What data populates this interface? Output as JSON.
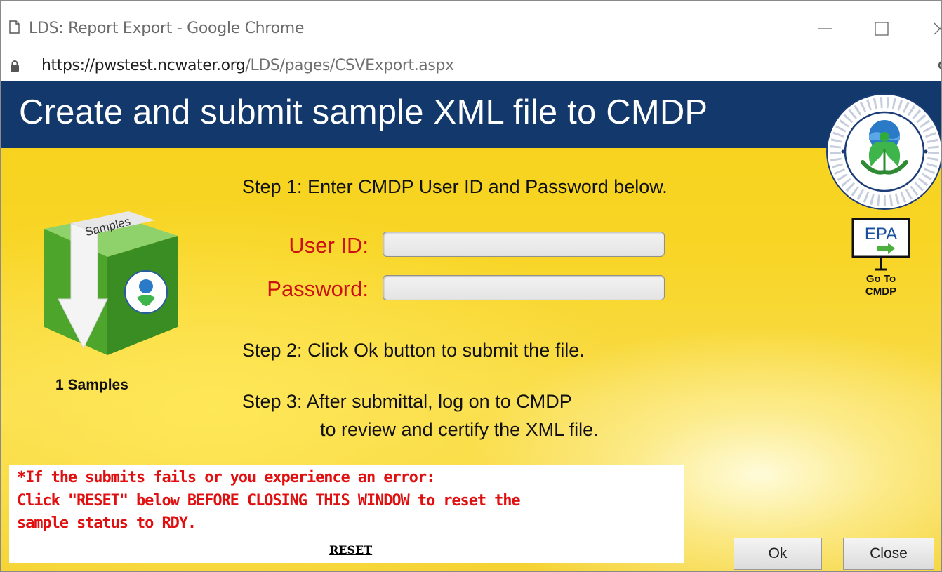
{
  "window": {
    "title": "LDS: Report Export - Google Chrome",
    "controls": [
      "minimize-icon",
      "maximize-icon",
      "close-icon"
    ]
  },
  "address_bar": {
    "url_host": "https://pwstest.ncwater.org",
    "url_path": "/LDS/pages/CSVExport.aspx",
    "icon": "lock-icon"
  },
  "banner": {
    "title": "Create and submit sample XML file to CMDP",
    "seal_icon": "epa-seal"
  },
  "samples": {
    "box_label": "Samples",
    "count_text": "1 Samples"
  },
  "steps": {
    "step1": "Step 1: Enter CMDP User ID and Password below.",
    "step2": "Step 2: Click Ok button to submit the file.",
    "step3_line1": "Step 3: After submittal, log on to CMDP",
    "step3_line2": "to review and certify the XML file."
  },
  "form": {
    "user_id_label": "User ID:",
    "user_id_value": "",
    "password_label": "Password:",
    "password_value": ""
  },
  "goto_cmdp": {
    "icon_text": "EPA",
    "line1": "Go To",
    "line2": "CMDP"
  },
  "warning": {
    "line1": "*If the submits fails or you experience an error:",
    "line2": "Click \"RESET\" below BEFORE CLOSING THIS WINDOW to reset the",
    "line3": "sample status to RDY.",
    "reset_label": "RESET"
  },
  "buttons": {
    "ok_label": "Ok",
    "close_label": "Close"
  },
  "colors": {
    "banner": "#13386b",
    "label_red": "#cc1111",
    "warning_red": "#e01010",
    "background_yellow": "#f8d526",
    "box_green": "#5bb52e"
  }
}
